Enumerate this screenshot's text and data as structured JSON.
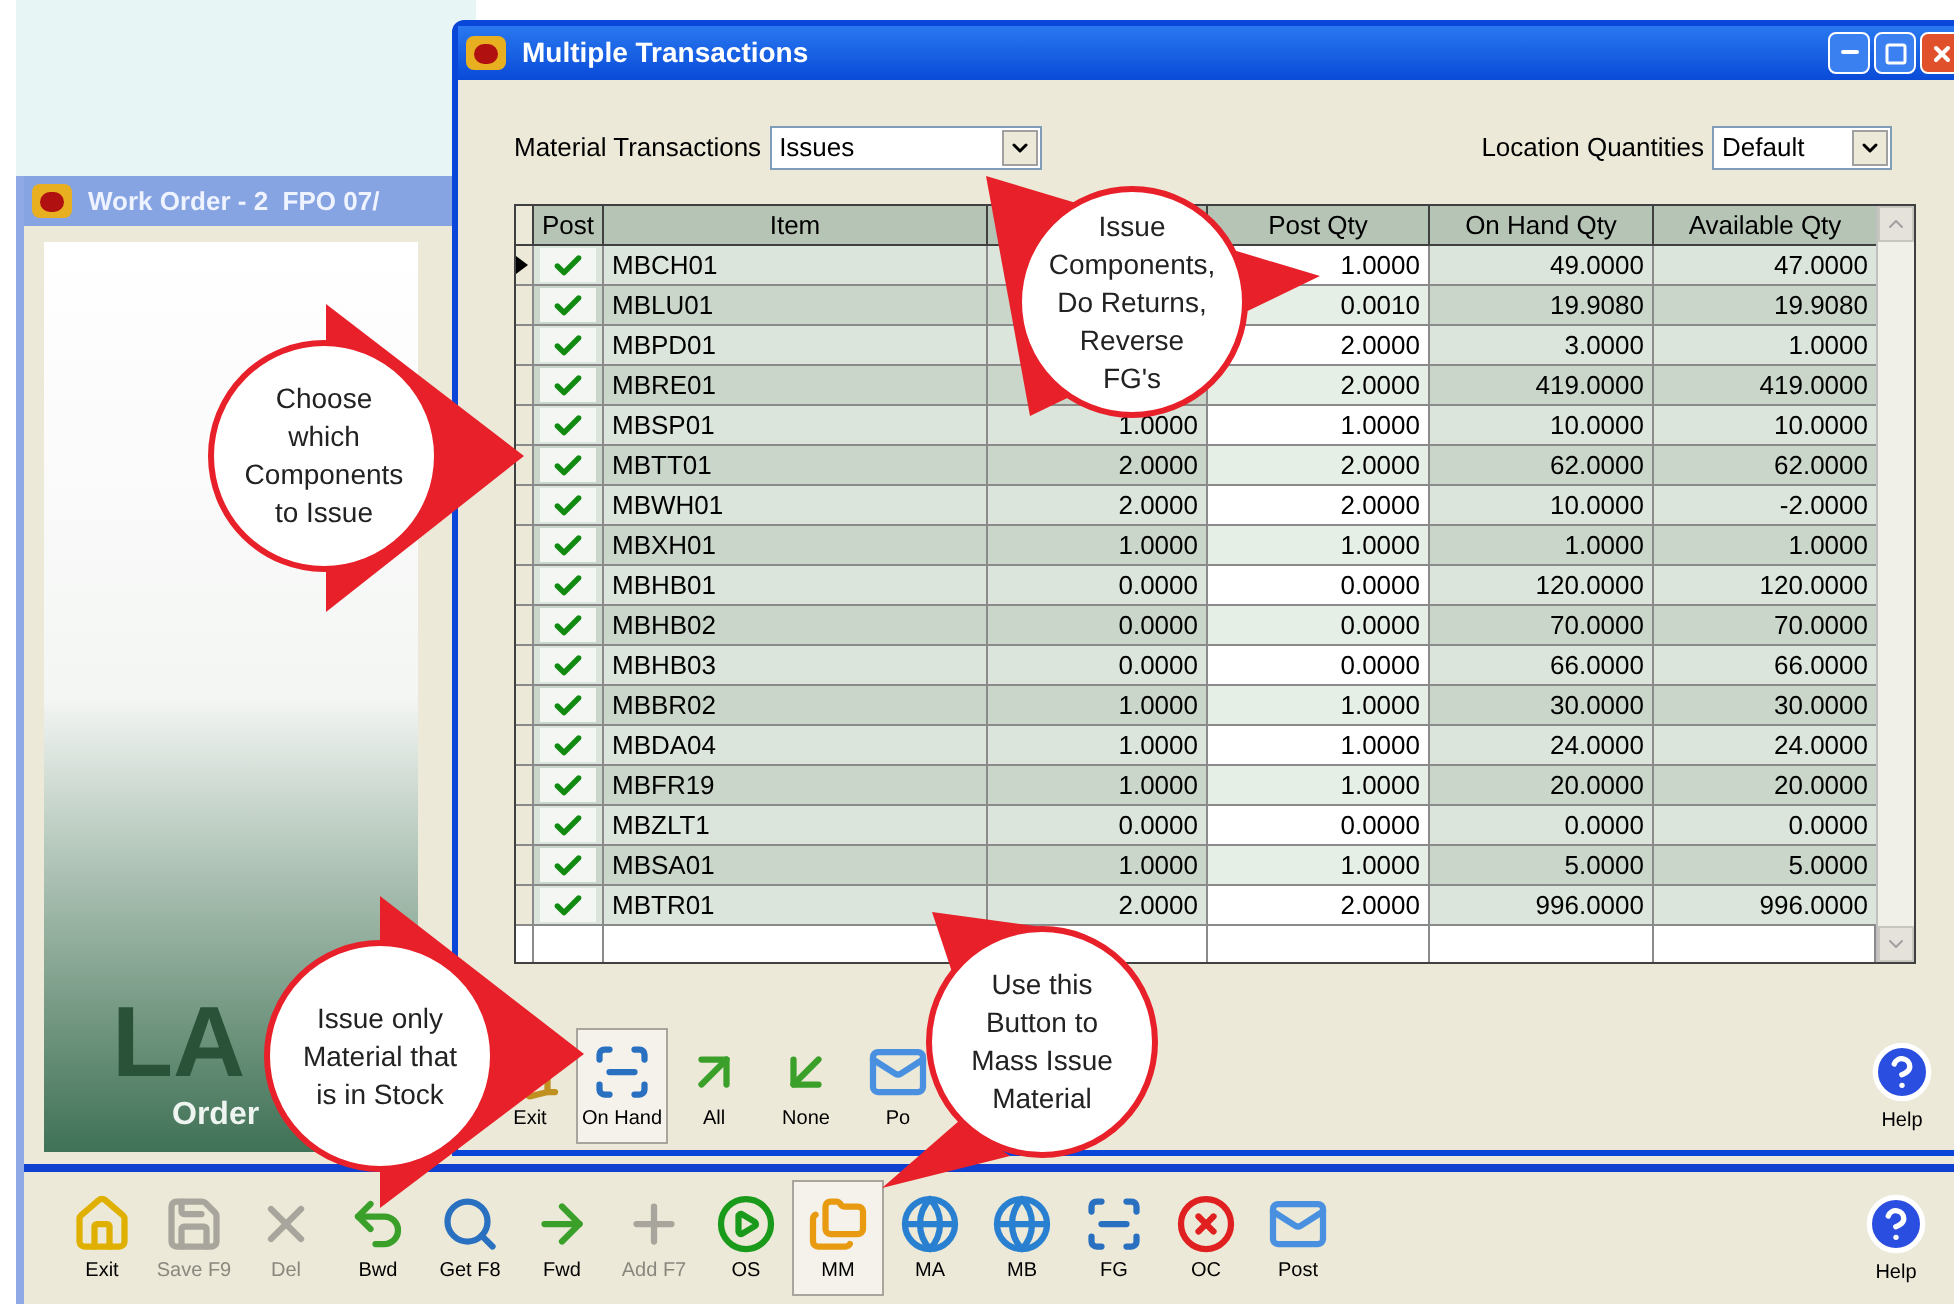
{
  "work_order_window": {
    "title": "Work Order - 2  FPO 07/",
    "logo_text": "LA",
    "panel_label": "Order"
  },
  "toolbar": [
    {
      "label": "Exit",
      "pressed": false,
      "disabled": false
    },
    {
      "label": "Save F9",
      "pressed": false,
      "disabled": true
    },
    {
      "label": "Del",
      "pressed": false,
      "disabled": true
    },
    {
      "label": "Bwd",
      "pressed": false,
      "disabled": false
    },
    {
      "label": "Get F8",
      "pressed": false,
      "disabled": false
    },
    {
      "label": "Fwd",
      "pressed": false,
      "disabled": false
    },
    {
      "label": "Add F7",
      "pressed": false,
      "disabled": true
    },
    {
      "label": "OS",
      "pressed": false,
      "disabled": false
    },
    {
      "label": "MM",
      "pressed": true,
      "disabled": false
    },
    {
      "label": "MA",
      "pressed": false,
      "disabled": false
    },
    {
      "label": "MB",
      "pressed": false,
      "disabled": false
    },
    {
      "label": "FG",
      "pressed": false,
      "disabled": false
    },
    {
      "label": "OC",
      "pressed": false,
      "disabled": false
    },
    {
      "label": "Post",
      "pressed": false,
      "disabled": false
    }
  ],
  "help": "Help",
  "dialog": {
    "title": "Multiple Transactions",
    "material_transactions": {
      "label": "Material Transactions",
      "value": "Issues"
    },
    "location_quantities": {
      "label": "Location Quantities",
      "value": "Default"
    },
    "columns": {
      "post": "Post",
      "item": "Item",
      "post_qty": "Post Qty",
      "on_hand_qty": "On Hand Qty",
      "available_qty": "Available Qty"
    },
    "rows": [
      {
        "selected": true,
        "checked": true,
        "item": "MBCH01",
        "post_qty": "1.0000",
        "on_hand_qty": "49.0000",
        "available_qty": "47.0000"
      },
      {
        "selected": false,
        "checked": true,
        "item": "MBLU01",
        "post_qty": "0.0010",
        "on_hand_qty": "19.9080",
        "available_qty": "19.9080"
      },
      {
        "selected": false,
        "checked": true,
        "item": "MBPD01",
        "post_qty": "2.0000",
        "on_hand_qty": "3.0000",
        "available_qty": "1.0000"
      },
      {
        "selected": false,
        "checked": true,
        "item": "MBRE01",
        "post_qty": "2.0000",
        "on_hand_qty": "419.0000",
        "available_qty": "419.0000"
      },
      {
        "selected": false,
        "checked": true,
        "item": "MBSP01",
        "column_3": "1.0000",
        "post_qty": "1.0000",
        "on_hand_qty": "10.0000",
        "available_qty": "10.0000"
      },
      {
        "selected": false,
        "checked": true,
        "item": "MBTT01",
        "column_3": "2.0000",
        "post_qty": "2.0000",
        "on_hand_qty": "62.0000",
        "available_qty": "62.0000"
      },
      {
        "selected": false,
        "checked": true,
        "item": "MBWH01",
        "column_3": "2.0000",
        "post_qty": "2.0000",
        "on_hand_qty": "10.0000",
        "available_qty": "-2.0000"
      },
      {
        "selected": false,
        "checked": true,
        "item": "MBXH01",
        "column_3": "1.0000",
        "post_qty": "1.0000",
        "on_hand_qty": "1.0000",
        "available_qty": "1.0000"
      },
      {
        "selected": false,
        "checked": true,
        "item": "MBHB01",
        "column_3": "0.0000",
        "post_qty": "0.0000",
        "on_hand_qty": "120.0000",
        "available_qty": "120.0000"
      },
      {
        "selected": false,
        "checked": true,
        "item": "MBHB02",
        "column_3": "0.0000",
        "post_qty": "0.0000",
        "on_hand_qty": "70.0000",
        "available_qty": "70.0000"
      },
      {
        "selected": false,
        "checked": true,
        "item": "MBHB03",
        "column_3": "0.0000",
        "post_qty": "0.0000",
        "on_hand_qty": "66.0000",
        "available_qty": "66.0000"
      },
      {
        "selected": false,
        "checked": true,
        "item": "MBBR02",
        "column_3": "1.0000",
        "post_qty": "1.0000",
        "on_hand_qty": "30.0000",
        "available_qty": "30.0000"
      },
      {
        "selected": false,
        "checked": true,
        "item": "MBDA04",
        "column_3": "1.0000",
        "post_qty": "1.0000",
        "on_hand_qty": "24.0000",
        "available_qty": "24.0000"
      },
      {
        "selected": false,
        "checked": true,
        "item": "MBFR19",
        "column_3": "1.0000",
        "post_qty": "1.0000",
        "on_hand_qty": "20.0000",
        "available_qty": "20.0000"
      },
      {
        "selected": false,
        "checked": true,
        "item": "MBZLT1",
        "column_3": "0.0000",
        "post_qty": "0.0000",
        "on_hand_qty": "0.0000",
        "available_qty": "0.0000"
      },
      {
        "selected": false,
        "checked": true,
        "item": "MBSA01",
        "column_3": "1.0000",
        "post_qty": "1.0000",
        "on_hand_qty": "5.0000",
        "available_qty": "5.0000"
      },
      {
        "selected": false,
        "checked": true,
        "item": "MBTR01",
        "column_3": "2.0000",
        "post_qty": "2.0000",
        "on_hand_qty": "996.0000",
        "available_qty": "996.0000"
      }
    ],
    "toolbar": [
      {
        "label": "Exit",
        "pressed": false
      },
      {
        "label": "On Hand",
        "pressed": true
      },
      {
        "label": "All",
        "pressed": false
      },
      {
        "label": "None",
        "pressed": false
      },
      {
        "label": "Po",
        "pressed": false
      }
    ],
    "help": "Help"
  },
  "callouts": [
    {
      "lines": [
        "Choose",
        "which",
        "Components",
        "to Issue"
      ]
    },
    {
      "lines": [
        "Issue",
        "Components,",
        "Do Returns,",
        "Reverse",
        "FG's"
      ]
    },
    {
      "lines": [
        "Issue only",
        "Material that",
        "is in Stock"
      ]
    },
    {
      "lines": [
        "Use this",
        "Button to",
        "Mass Issue",
        "Material"
      ]
    }
  ]
}
